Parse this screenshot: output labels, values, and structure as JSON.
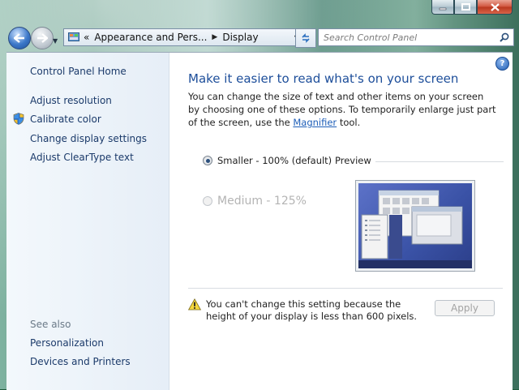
{
  "window": {
    "minimize_icon": "minimize-icon",
    "maximize_icon": "maximize-icon",
    "close_icon": "close-icon"
  },
  "nav": {
    "back_icon": "back-arrow-icon",
    "forward_icon": "forward-arrow-icon",
    "overflow": "«",
    "breadcrumb": [
      "Appearance and Pers...",
      "Display"
    ],
    "search_placeholder": "Search Control Panel"
  },
  "sidebar": {
    "home": "Control Panel Home",
    "tasks": [
      "Adjust resolution",
      "Calibrate color",
      "Change display settings",
      "Adjust ClearType text"
    ],
    "see_also_label": "See also",
    "see_also": [
      "Personalization",
      "Devices and Printers"
    ]
  },
  "main": {
    "title": "Make it easier to read what's on your screen",
    "desc_before": "You can change the size of text and other items on your screen by choosing one of these options. To temporarily enlarge just part of the screen, use the ",
    "desc_link": "Magnifier",
    "desc_after": " tool.",
    "options": [
      {
        "label": "Smaller - 100% (default)",
        "selected": true,
        "enabled": true
      },
      {
        "label": "Medium - 125%",
        "selected": false,
        "enabled": false
      }
    ],
    "preview_label": "Preview",
    "warning": "You can't change this setting because the height of your display is less than 600 pixels.",
    "apply_label": "Apply",
    "help_glyph": "?"
  },
  "colors": {
    "link": "#1b3a6a",
    "heading": "#1d4e9a",
    "sidebar_bg": "#e6eef7"
  }
}
